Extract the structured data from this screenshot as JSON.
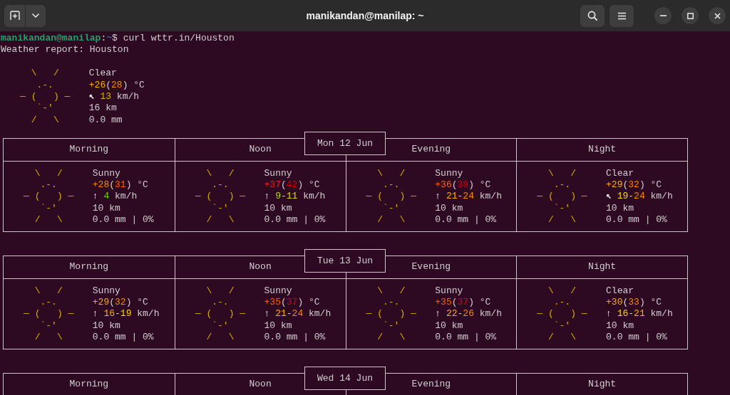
{
  "window": {
    "title": "manikandan@manilap: ~"
  },
  "prompt": [
    {
      "text": "manikandan@manilap",
      "color": "#26a269"
    },
    {
      "text": ":"
    },
    {
      "text": "~",
      "color": "#3465a4"
    },
    {
      "text": "$ curl wttr.in/Houston"
    }
  ],
  "report_title": "Weather report: Houston",
  "current": {
    "icon": [
      "\\   /",
      ".-.",
      "― (   ) ―",
      "`-'",
      "/   \\"
    ],
    "condition": "Clear",
    "temperature": [
      {
        "text": "+26",
        "color": "#ffaf00"
      },
      {
        "text": "("
      },
      {
        "text": "28",
        "color": "#ff8700"
      },
      {
        "text": ") °C"
      }
    ],
    "wind": [
      {
        "text": "↖ "
      },
      {
        "text": "13",
        "color": "#d7af00"
      },
      {
        "text": " km/h"
      }
    ],
    "visibility": "16 km",
    "precipitation": "0.0 mm"
  },
  "days": [
    {
      "date": "Mon 12 Jun",
      "periods": [
        {
          "name": "Morning",
          "icon": [
            "\\   /",
            ".-.",
            "― (   ) ―",
            "`-'",
            "/   \\"
          ],
          "condition": "Sunny",
          "temperature": [
            {
              "text": "+28",
              "color": "#ff8700"
            },
            {
              "text": "("
            },
            {
              "text": "31",
              "color": "#ff5f00"
            },
            {
              "text": ") °C"
            }
          ],
          "wind": [
            {
              "text": "↑ "
            },
            {
              "text": "4",
              "color": "#5fd700"
            },
            {
              "text": " km/h"
            }
          ],
          "visibility": "10 km",
          "precipitation": "0.0 mm | 0%"
        },
        {
          "name": "Noon",
          "icon": [
            "\\   /",
            ".-.",
            "― (   ) ―",
            "`-'",
            "/   \\"
          ],
          "condition": "Sunny",
          "temperature": [
            {
              "text": "+37",
              "color": "#e0241c"
            },
            {
              "text": "("
            },
            {
              "text": "42",
              "color": "#d70000"
            },
            {
              "text": ") °C"
            }
          ],
          "wind": [
            {
              "text": "↑ "
            },
            {
              "text": "9",
              "color": "#afd700"
            },
            {
              "text": "-"
            },
            {
              "text": "11",
              "color": "#d7d700"
            },
            {
              "text": " km/h"
            }
          ],
          "visibility": "10 km",
          "precipitation": "0.0 mm | 0%"
        },
        {
          "name": "Evening",
          "icon": [
            "\\   /",
            ".-.",
            "― (   ) ―",
            "`-'",
            "/   \\"
          ],
          "condition": "Sunny",
          "temperature": [
            {
              "text": "+36",
              "color": "#ff5f00"
            },
            {
              "text": "("
            },
            {
              "text": "38",
              "color": "#d70000"
            },
            {
              "text": ") °C"
            }
          ],
          "wind": [
            {
              "text": "↑ "
            },
            {
              "text": "21",
              "color": "#ffaf00"
            },
            {
              "text": "-"
            },
            {
              "text": "24",
              "color": "#ff8700"
            },
            {
              "text": " km/h"
            }
          ],
          "visibility": "10 km",
          "precipitation": "0.0 mm | 0%"
        },
        {
          "name": "Night",
          "icon": [
            "\\   /",
            ".-.",
            "― (   ) ―",
            "`-'",
            "/   \\"
          ],
          "condition": "Clear",
          "temperature": [
            {
              "text": "+29",
              "color": "#ffaf00"
            },
            {
              "text": "("
            },
            {
              "text": "32",
              "color": "#ff8700"
            },
            {
              "text": ") °C"
            }
          ],
          "wind": [
            {
              "text": "↖ "
            },
            {
              "text": "19",
              "color": "#ffd700"
            },
            {
              "text": "-"
            },
            {
              "text": "24",
              "color": "#ff8700"
            },
            {
              "text": " km/h"
            }
          ],
          "visibility": "10 km",
          "precipitation": "0.0 mm | 0%"
        }
      ]
    },
    {
      "date": "Tue 13 Jun",
      "periods": [
        {
          "name": "Morning",
          "icon": [
            "\\   /",
            ".-.",
            "― (   ) ―",
            "`-'",
            "/   \\"
          ],
          "condition": "Sunny",
          "temperature": [
            {
              "text": "+29",
              "color": "#ffaf00"
            },
            {
              "text": "("
            },
            {
              "text": "32",
              "color": "#ff8700"
            },
            {
              "text": ") °C"
            }
          ],
          "wind": [
            {
              "text": "↑ "
            },
            {
              "text": "16",
              "color": "#ffaf00"
            },
            {
              "text": "-"
            },
            {
              "text": "19",
              "color": "#ffd700"
            },
            {
              "text": " km/h"
            }
          ],
          "visibility": "10 km",
          "precipitation": "0.0 mm | 0%"
        },
        {
          "name": "Noon",
          "icon": [
            "\\   /",
            ".-.",
            "― (   ) ―",
            "`-'",
            "/   \\"
          ],
          "condition": "Sunny",
          "temperature": [
            {
              "text": "+35",
              "color": "#ff5f00"
            },
            {
              "text": "("
            },
            {
              "text": "37",
              "color": "#d70000"
            },
            {
              "text": ") °C"
            }
          ],
          "wind": [
            {
              "text": "↑ "
            },
            {
              "text": "21",
              "color": "#ffaf00"
            },
            {
              "text": "-"
            },
            {
              "text": "24",
              "color": "#ff8700"
            },
            {
              "text": " km/h"
            }
          ],
          "visibility": "10 km",
          "precipitation": "0.0 mm | 0%"
        },
        {
          "name": "Evening",
          "icon": [
            "\\   /",
            ".-.",
            "― (   ) ―",
            "`-'",
            "/   \\"
          ],
          "condition": "Sunny",
          "temperature": [
            {
              "text": "+35",
              "color": "#ff5f00"
            },
            {
              "text": "("
            },
            {
              "text": "37",
              "color": "#d70000"
            },
            {
              "text": ") °C"
            }
          ],
          "wind": [
            {
              "text": "↑ "
            },
            {
              "text": "22",
              "color": "#ffaf00"
            },
            {
              "text": "-"
            },
            {
              "text": "26",
              "color": "#ff8700"
            },
            {
              "text": " km/h"
            }
          ],
          "visibility": "10 km",
          "precipitation": "0.0 mm | 0%"
        },
        {
          "name": "Night",
          "icon": [
            "\\   /",
            ".-.",
            "― (   ) ―",
            "`-'",
            "/   \\"
          ],
          "condition": "Clear",
          "temperature": [
            {
              "text": "+30",
              "color": "#ffaf00"
            },
            {
              "text": "("
            },
            {
              "text": "33",
              "color": "#ff8700"
            },
            {
              "text": ") °C"
            }
          ],
          "wind": [
            {
              "text": "↑ "
            },
            {
              "text": "16",
              "color": "#ffd700"
            },
            {
              "text": "-"
            },
            {
              "text": "21",
              "color": "#ffaf00"
            },
            {
              "text": " km/h"
            }
          ],
          "visibility": "10 km",
          "precipitation": "0.0 mm | 0%"
        }
      ]
    },
    {
      "date": "Wed 14 Jun",
      "periods": [
        {
          "name": "Morning"
        },
        {
          "name": "Noon"
        },
        {
          "name": "Evening"
        },
        {
          "name": "Night"
        }
      ]
    }
  ]
}
